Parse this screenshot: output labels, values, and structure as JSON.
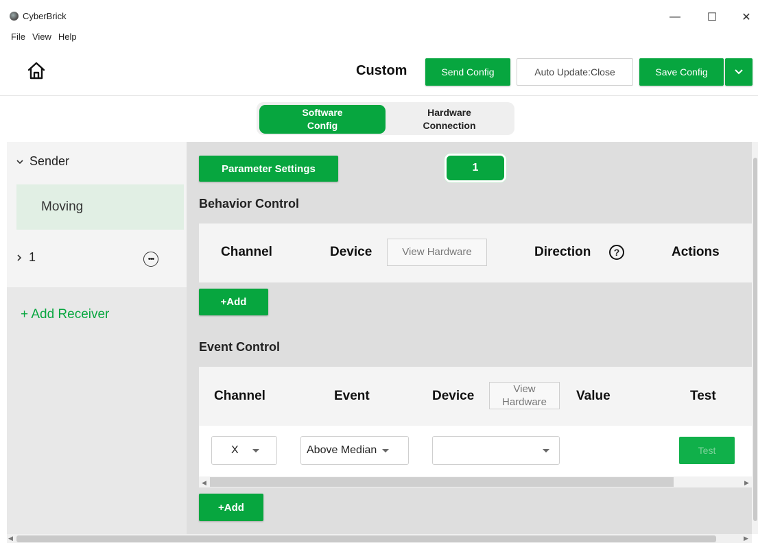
{
  "window": {
    "title": "CyberBrick",
    "minimize": "—",
    "maximize": "☐",
    "close": "✕"
  },
  "menu": [
    {
      "label": "File"
    },
    {
      "label": "View"
    },
    {
      "label": "Help"
    }
  ],
  "header": {
    "title": "Custom",
    "send_config": "Send Config",
    "auto_update": "Auto Update:Close",
    "save_config": "Save Config"
  },
  "segment": {
    "active_line1": "Software",
    "active_line2": "Config",
    "inactive_line1": "Hardware",
    "inactive_line2": "Connection"
  },
  "sidebar": {
    "sender_label": "Sender",
    "sender_child": "Moving",
    "receiver_label": "1",
    "add_receiver": "+ Add Receiver"
  },
  "main": {
    "parameter_settings": "Parameter Settings",
    "receiver_badge": "1",
    "behavior_title": "Behavior Control",
    "behavior_columns": {
      "channel": "Channel",
      "device": "Device",
      "view_hardware": "View Hardware",
      "direction": "Direction",
      "actions": "Actions"
    },
    "behavior_add": "+Add",
    "event_title": "Event Control",
    "event_columns": {
      "channel": "Channel",
      "event": "Event",
      "device": "Device",
      "view_line1": "View",
      "view_line2": "Hardware",
      "value": "Value",
      "test": "Test"
    },
    "event_row": {
      "channel": "X",
      "event": "Above Median",
      "device": "",
      "test": "Test"
    },
    "event_add": "+Add"
  },
  "colors": {
    "accent": "#07a63f",
    "selected_bg": "#e1efe4"
  }
}
